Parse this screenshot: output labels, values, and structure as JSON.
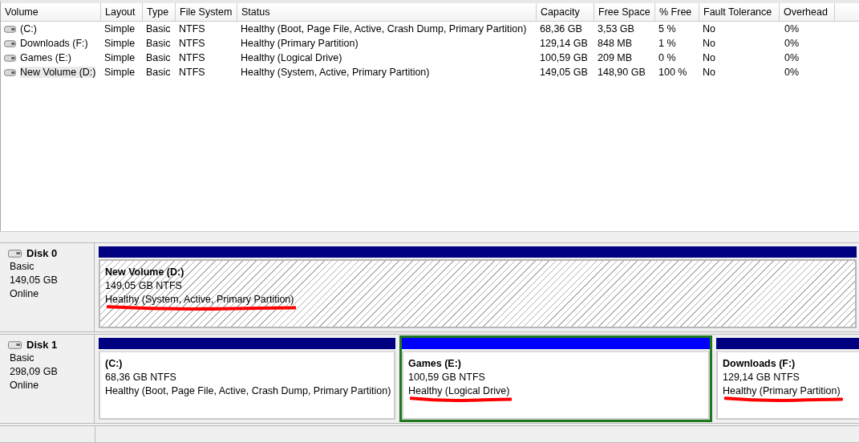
{
  "volume_table": {
    "columns": [
      "Volume",
      "Layout",
      "Type",
      "File System",
      "Status",
      "Capacity",
      "Free Space",
      "% Free",
      "Fault Tolerance",
      "Overhead"
    ],
    "rows": [
      {
        "cells": [
          "(C:)",
          "Simple",
          "Basic",
          "NTFS",
          "Healthy (Boot, Page File, Active, Crash Dump, Primary Partition)",
          "68,36 GB",
          "3,53 GB",
          "5 %",
          "No",
          "0%"
        ],
        "selected": false
      },
      {
        "cells": [
          "Downloads (F:)",
          "Simple",
          "Basic",
          "NTFS",
          "Healthy (Primary Partition)",
          "129,14 GB",
          "848 MB",
          "1 %",
          "No",
          "0%"
        ],
        "selected": false
      },
      {
        "cells": [
          "Games (E:)",
          "Simple",
          "Basic",
          "NTFS",
          "Healthy (Logical Drive)",
          "100,59 GB",
          "209 MB",
          "0 %",
          "No",
          "0%"
        ],
        "selected": false
      },
      {
        "cells": [
          "New Volume (D:)",
          "Simple",
          "Basic",
          "NTFS",
          "Healthy (System, Active, Primary Partition)",
          "149,05 GB",
          "148,90 GB",
          "100 %",
          "No",
          "0%"
        ],
        "selected": true
      }
    ]
  },
  "disks": [
    {
      "name": "Disk 0",
      "type": "Basic",
      "size": "149,05 GB",
      "status": "Online",
      "partitions": [
        {
          "kind": "primary",
          "name": "New Volume  (D:)",
          "size": "149,05 GB NTFS",
          "status": "Healthy (System, Active, Primary Partition)",
          "selected": true,
          "underlined": true
        }
      ]
    },
    {
      "name": "Disk 1",
      "type": "Basic",
      "size": "298,09 GB",
      "status": "Online",
      "partitions": [
        {
          "kind": "primary",
          "name": "(C:)",
          "size": "68,36 GB NTFS",
          "status": "Healthy (Boot, Page File, Active, Crash Dump, Primary Partition)",
          "selected": false,
          "underlined": false
        },
        {
          "kind": "logical",
          "name": "Games  (E:)",
          "size": "100,59 GB NTFS",
          "status": "Healthy (Logical Drive)",
          "selected": false,
          "underlined": true
        },
        {
          "kind": "primary",
          "name": "Downloads  (F:)",
          "size": "129,14 GB NTFS",
          "status": "Healthy (Primary Partition)",
          "selected": false,
          "underlined": true
        }
      ]
    }
  ]
}
